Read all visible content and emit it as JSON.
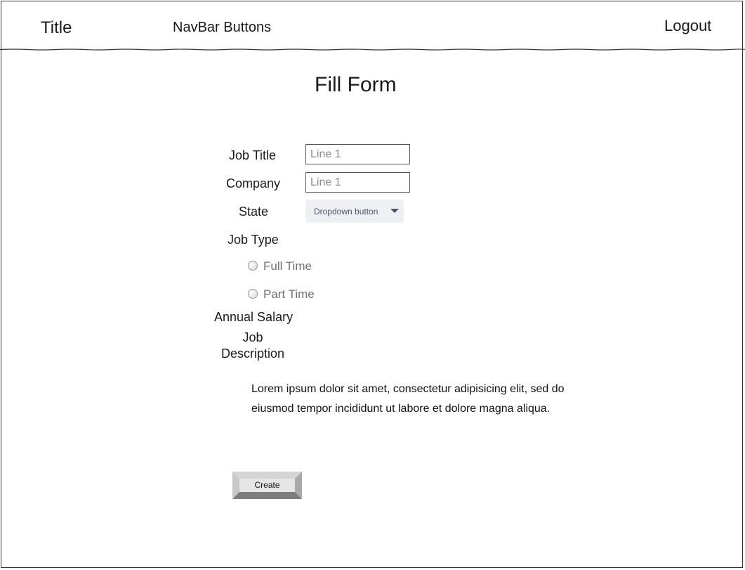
{
  "header": {
    "title": "Title",
    "nav_buttons": "NavBar Buttons",
    "logout": "Logout"
  },
  "form": {
    "title": "Fill Form",
    "job_title": {
      "label": "Job Title",
      "placeholder": "Line 1"
    },
    "company": {
      "label": "Company",
      "placeholder": "Line 1"
    },
    "state": {
      "label": "State",
      "dropdown": "Dropdown button"
    },
    "job_type": {
      "label": "Job Type",
      "options": [
        "Full Time",
        "Part Time"
      ]
    },
    "annual_salary": {
      "label": "Annual Salary"
    },
    "job_description": {
      "label_line1": "Job",
      "label_line2": "Description",
      "text_line1": "Lorem ipsum dolor sit amet, consectetur adipisicing elit, sed do",
      "text_line2": "eiusmod tempor incididunt ut labore et dolore magna aliqua."
    },
    "create_button": "Create"
  },
  "colors": {
    "border": "#333333",
    "dropdown_bg": "#eef0f3",
    "button_face": "#e6e6e6"
  }
}
